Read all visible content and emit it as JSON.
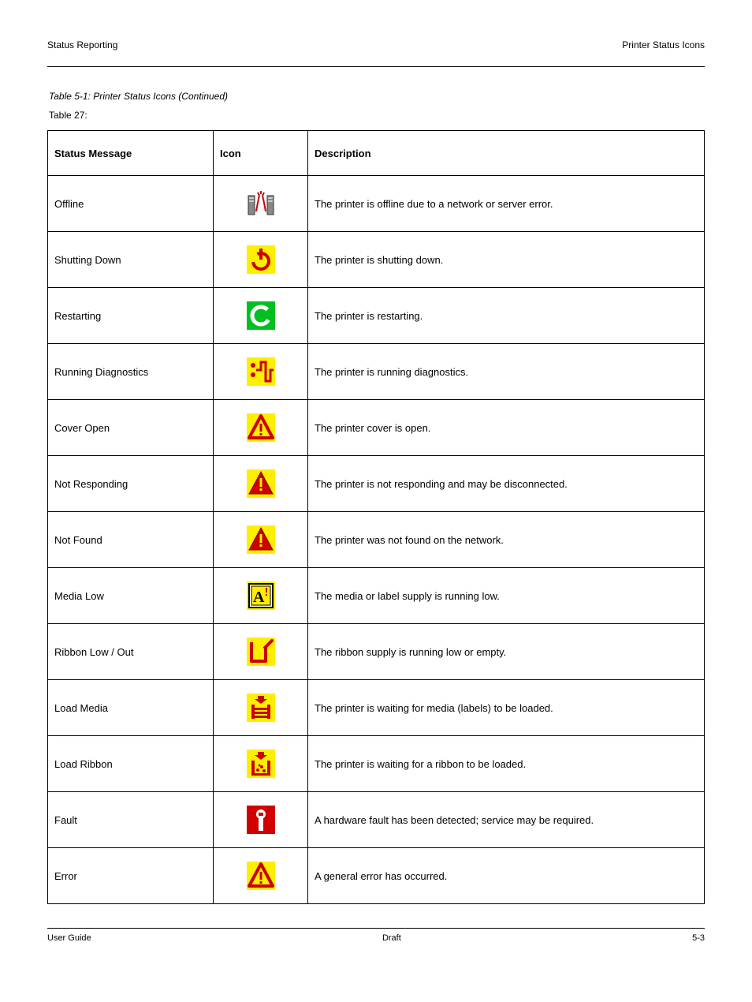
{
  "header": {
    "left": "Status Reporting",
    "right": "Printer Status Icons"
  },
  "section": "Table 5-1: Printer Status Icons (Continued)",
  "subsection": "Table 27:",
  "table": {
    "headers": [
      "Status Message",
      "Icon",
      "Description"
    ],
    "rows": [
      {
        "status": "Offline",
        "name": "offline-icon",
        "desc": "The printer is offline due to a network or server error."
      },
      {
        "status": "Shutting Down",
        "name": "shutting-down-icon",
        "desc": "The printer is shutting down."
      },
      {
        "status": "Restarting",
        "name": "restarting-icon",
        "desc": "The printer is restarting."
      },
      {
        "status": "Running Diagnostics",
        "name": "diagnostics-icon",
        "desc": "The printer is running diagnostics."
      },
      {
        "status": "Cover Open",
        "name": "cover-open-icon",
        "desc": "The printer cover is open."
      },
      {
        "status": "Not Responding",
        "name": "not-responding-icon",
        "desc": "The printer is not responding and may be disconnected."
      },
      {
        "status": "Not Found",
        "name": "not-found-icon",
        "desc": "The printer was not found on the network."
      },
      {
        "status": "Media Low",
        "name": "media-low-icon",
        "desc": "The media or label supply is running low."
      },
      {
        "status": "Ribbon Low / Out",
        "name": "ribbon-low-icon",
        "desc": "The ribbon supply is running low or empty."
      },
      {
        "status": "Load Media",
        "name": "load-media-icon",
        "desc": "The printer is waiting for media (labels) to be loaded."
      },
      {
        "status": "Load Ribbon",
        "name": "load-ribbon-icon",
        "desc": "The printer is waiting for a ribbon to be loaded."
      },
      {
        "status": "Fault",
        "name": "fault-icon",
        "desc": "A hardware fault has been detected; service may be required."
      },
      {
        "status": "Error",
        "name": "error-icon",
        "desc": "A general error has occurred."
      }
    ]
  },
  "footer": {
    "left": "User Guide",
    "center": "Draft",
    "right": "5-3"
  }
}
